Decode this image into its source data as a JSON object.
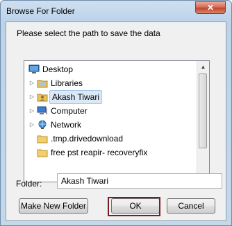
{
  "window": {
    "title": "Browse For Folder",
    "close_label": "✕"
  },
  "prompt": "Please select the path to save the data",
  "tree": {
    "items": [
      {
        "label": "Desktop",
        "icon": "desktop-icon",
        "expander": ""
      },
      {
        "label": "Libraries",
        "icon": "libraries-folder-icon",
        "expander": "▷"
      },
      {
        "label": "Akash Tiwari",
        "icon": "user-folder-icon",
        "expander": "▷",
        "selected": true
      },
      {
        "label": "Computer",
        "icon": "computer-icon",
        "expander": "▷"
      },
      {
        "label": "Network",
        "icon": "network-icon",
        "expander": "▷"
      },
      {
        "label": ".tmp.drivedownload",
        "icon": "folder-icon",
        "expander": ""
      },
      {
        "label": "free pst reapir- recoveryfix",
        "icon": "folder-icon",
        "expander": ""
      }
    ]
  },
  "folder": {
    "label": "Folder:",
    "value": "Akash Tiwari"
  },
  "buttons": {
    "make_new_folder": "Make New Folder",
    "ok": "OK",
    "cancel": "Cancel"
  },
  "colors": {
    "selection": "#dbe8f6",
    "ok_border": "#7a1e22",
    "close_button": "#c3452b"
  }
}
